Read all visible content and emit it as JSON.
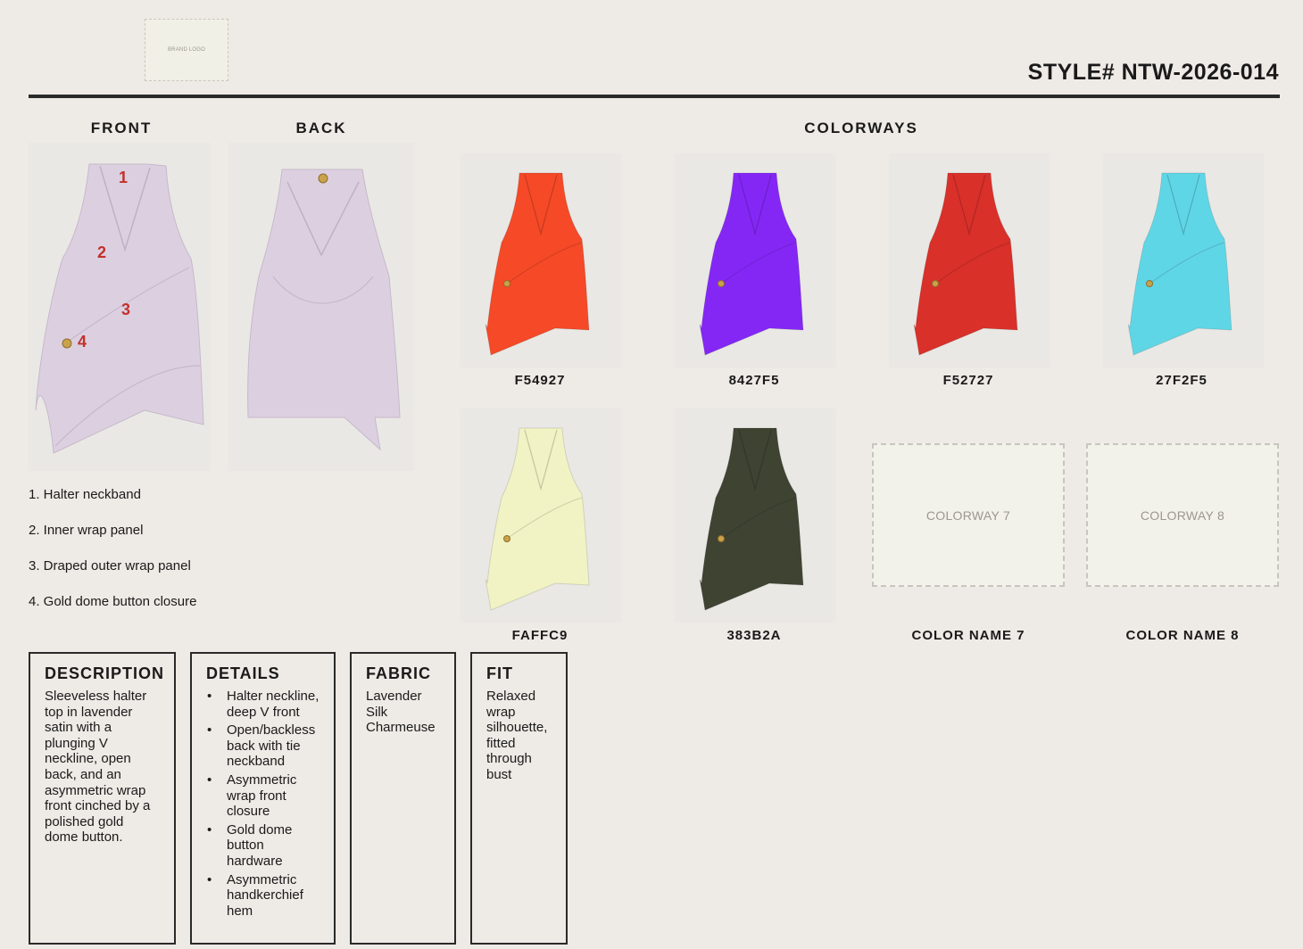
{
  "header": {
    "logo_text": "BRAND LOGO",
    "style_number": "STYLE# NTW-2026-014"
  },
  "sections": {
    "front": "FRONT",
    "back": "BACK",
    "colorways": "COLORWAYS"
  },
  "callouts": [
    "1",
    "2",
    "3",
    "4"
  ],
  "legend": [
    "1. Halter neckband",
    "2. Inner wrap panel",
    "3. Draped outer wrap panel",
    "4. Gold dome button closure"
  ],
  "colorways": [
    {
      "code": "F54927",
      "color": "#f54927"
    },
    {
      "code": "8427F5",
      "color": "#8427f5"
    },
    {
      "code": "F52727",
      "color": "#d9302a"
    },
    {
      "code": "27F2F5",
      "color": "#5fd6e6"
    },
    {
      "code": "FAFFC9",
      "color": "#f1f3c4"
    },
    {
      "code": "383B2A",
      "color": "#3f4332"
    }
  ],
  "placeholders": [
    {
      "label": "COLORWAY 7",
      "name": "COLOR NAME 7"
    },
    {
      "label": "COLORWAY 8",
      "name": "COLOR NAME 8"
    }
  ],
  "garment_color": "#dcd0e0",
  "spec": {
    "description": {
      "title": "DESCRIPTION",
      "body": "Sleeveless halter top in lavender satin with a plunging V neckline, open back, and an asymmetric wrap front cinched by a polished gold dome button."
    },
    "details": {
      "title": "DETAILS",
      "items": [
        "Halter neckline, deep V front",
        "Open/backless back with tie neckband",
        "Asymmetric wrap front closure",
        "Gold dome button hardware",
        "Asymmetric handkerchief hem"
      ]
    },
    "fabric": {
      "title": "FABRIC",
      "body": "Lavender Silk Charmeuse"
    },
    "fit": {
      "title": "FIT",
      "body": "Relaxed wrap silhouette, fitted through bust"
    }
  }
}
